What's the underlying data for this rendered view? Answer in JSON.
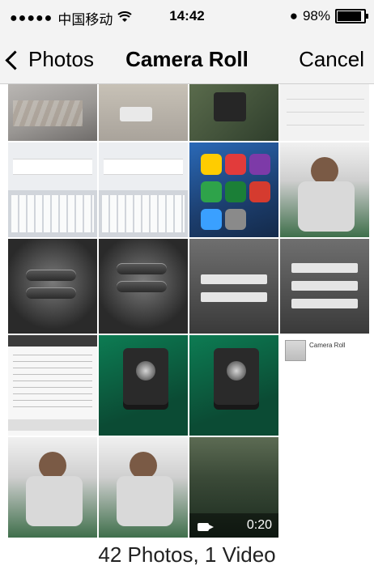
{
  "status_bar": {
    "carrier": "中国移动",
    "time": "14:42",
    "battery_percent": "98%",
    "battery_level": 0.98
  },
  "nav": {
    "back_label": "Photos",
    "title": "Camera Roll",
    "cancel_label": "Cancel"
  },
  "grid": {
    "video_duration": "0:20",
    "album_thumb_label": "Camera Roll"
  },
  "footer": {
    "summary": "42 Photos, 1 Video"
  },
  "icons": {
    "back": "chevron-left-icon",
    "wifi": "wifi-icon",
    "video": "video-camera-icon"
  }
}
